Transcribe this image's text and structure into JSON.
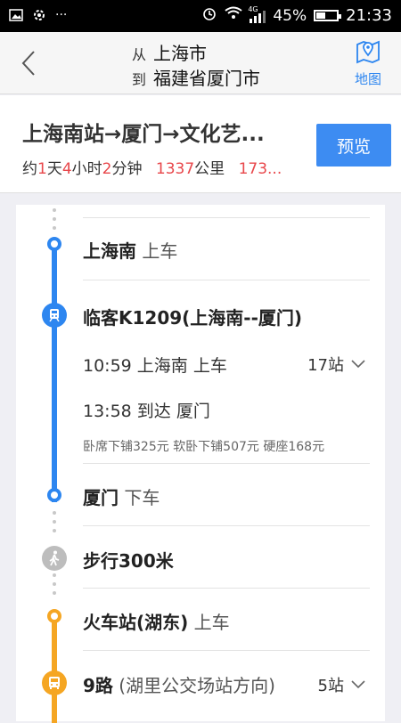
{
  "status": {
    "signal_label": "4G",
    "battery_percent": "45%",
    "battery_level": 0.45,
    "time": "21:33",
    "dots": "···"
  },
  "header": {
    "from_prefix": "从",
    "from_place": "上海市",
    "to_prefix": "到",
    "to_place": "福建省厦门市",
    "map_label": "地图"
  },
  "summary": {
    "title": "上海南站→厦门→文化艺...",
    "meta": {
      "p1": "约",
      "days": "1",
      "p2": "天",
      "hours": "4",
      "p3": "小时",
      "mins": "2",
      "p4": "分钟",
      "distance": "1337",
      "p5": "公里",
      "price": "173..."
    },
    "preview_label": "预览"
  },
  "steps": {
    "board1": {
      "station": "上海南",
      "action": "上车"
    },
    "train": {
      "name": "临客K1209(上海南--厦门)",
      "depart": "10:59 上海南 上车",
      "stops": "17站",
      "arrive": "13:58 到达 厦门",
      "prices": "卧席下铺325元  软卧下铺507元  硬座168元"
    },
    "alight1": {
      "station": "厦门",
      "action": "下车"
    },
    "walk": {
      "label": "步行300米"
    },
    "board2": {
      "station": "火车站(湖东)",
      "action": "上车"
    },
    "bus": {
      "route": "9路",
      "direction": "(湖里公交场站方向)",
      "stops": "5站"
    }
  },
  "colors": {
    "blue": "#2d86f0",
    "orange": "#f5a623",
    "red": "#e8474b",
    "gray": "#bdbdbd"
  }
}
